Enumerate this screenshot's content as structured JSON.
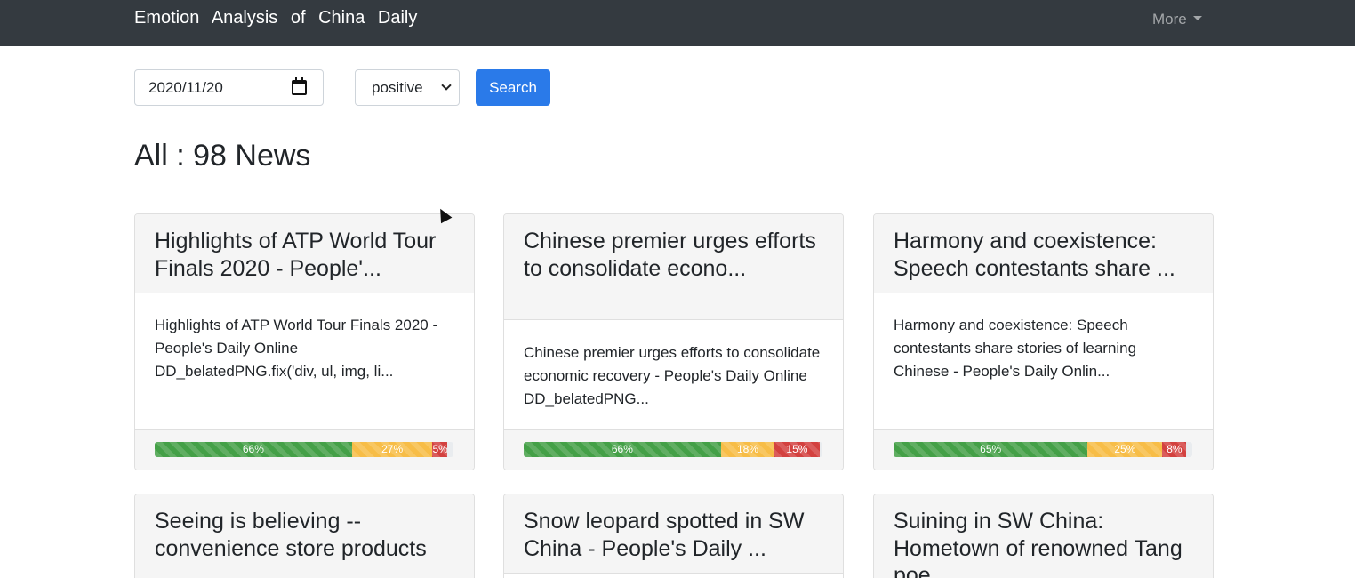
{
  "navbar": {
    "brand": "Emotion Analysis of China Daily",
    "more_label": "More"
  },
  "filters": {
    "date_value": "2020/11/20",
    "sentiment_selected": "positive",
    "search_label": "Search"
  },
  "summary": {
    "title": "All : 98 News"
  },
  "cards": [
    {
      "title": "Highlights of ATP World Tour Finals 2020 - People'...",
      "body": "Highlights of ATP World Tour Finals 2020 - People's Daily Online DD_belatedPNG.fix('div, ul, img, li...",
      "positive": 66,
      "neutral": 27,
      "negative": 5,
      "positive_label": "66%",
      "neutral_label": "27%",
      "negative_label": "5%"
    },
    {
      "title": "Chinese premier urges efforts to consolidate econo...",
      "body": "Chinese premier urges efforts to consolidate economic recovery - People's Daily Online DD_belatedPNG...",
      "positive": 66,
      "neutral": 18,
      "negative": 15,
      "positive_label": "66%",
      "neutral_label": "18%",
      "negative_label": "15%"
    },
    {
      "title": "Harmony and coexistence: Speech contestants share ...",
      "body": "Harmony and coexistence: Speech contestants share stories of learning Chinese - People's Daily Onlin...",
      "positive": 65,
      "neutral": 25,
      "negative": 8,
      "positive_label": "65%",
      "neutral_label": "25%",
      "negative_label": "8%"
    },
    {
      "title": "Seeing is believing -- convenience store products"
    },
    {
      "title": "Snow leopard spotted in SW China - People's Daily ..."
    },
    {
      "title": "Suining in SW China: Hometown of renowned Tang poe..."
    }
  ],
  "colors": {
    "navbar": "#343a40",
    "primary": "#2a7ae9",
    "positive": "#44a047",
    "neutral": "#f7bd47",
    "negative": "#d3413f"
  }
}
